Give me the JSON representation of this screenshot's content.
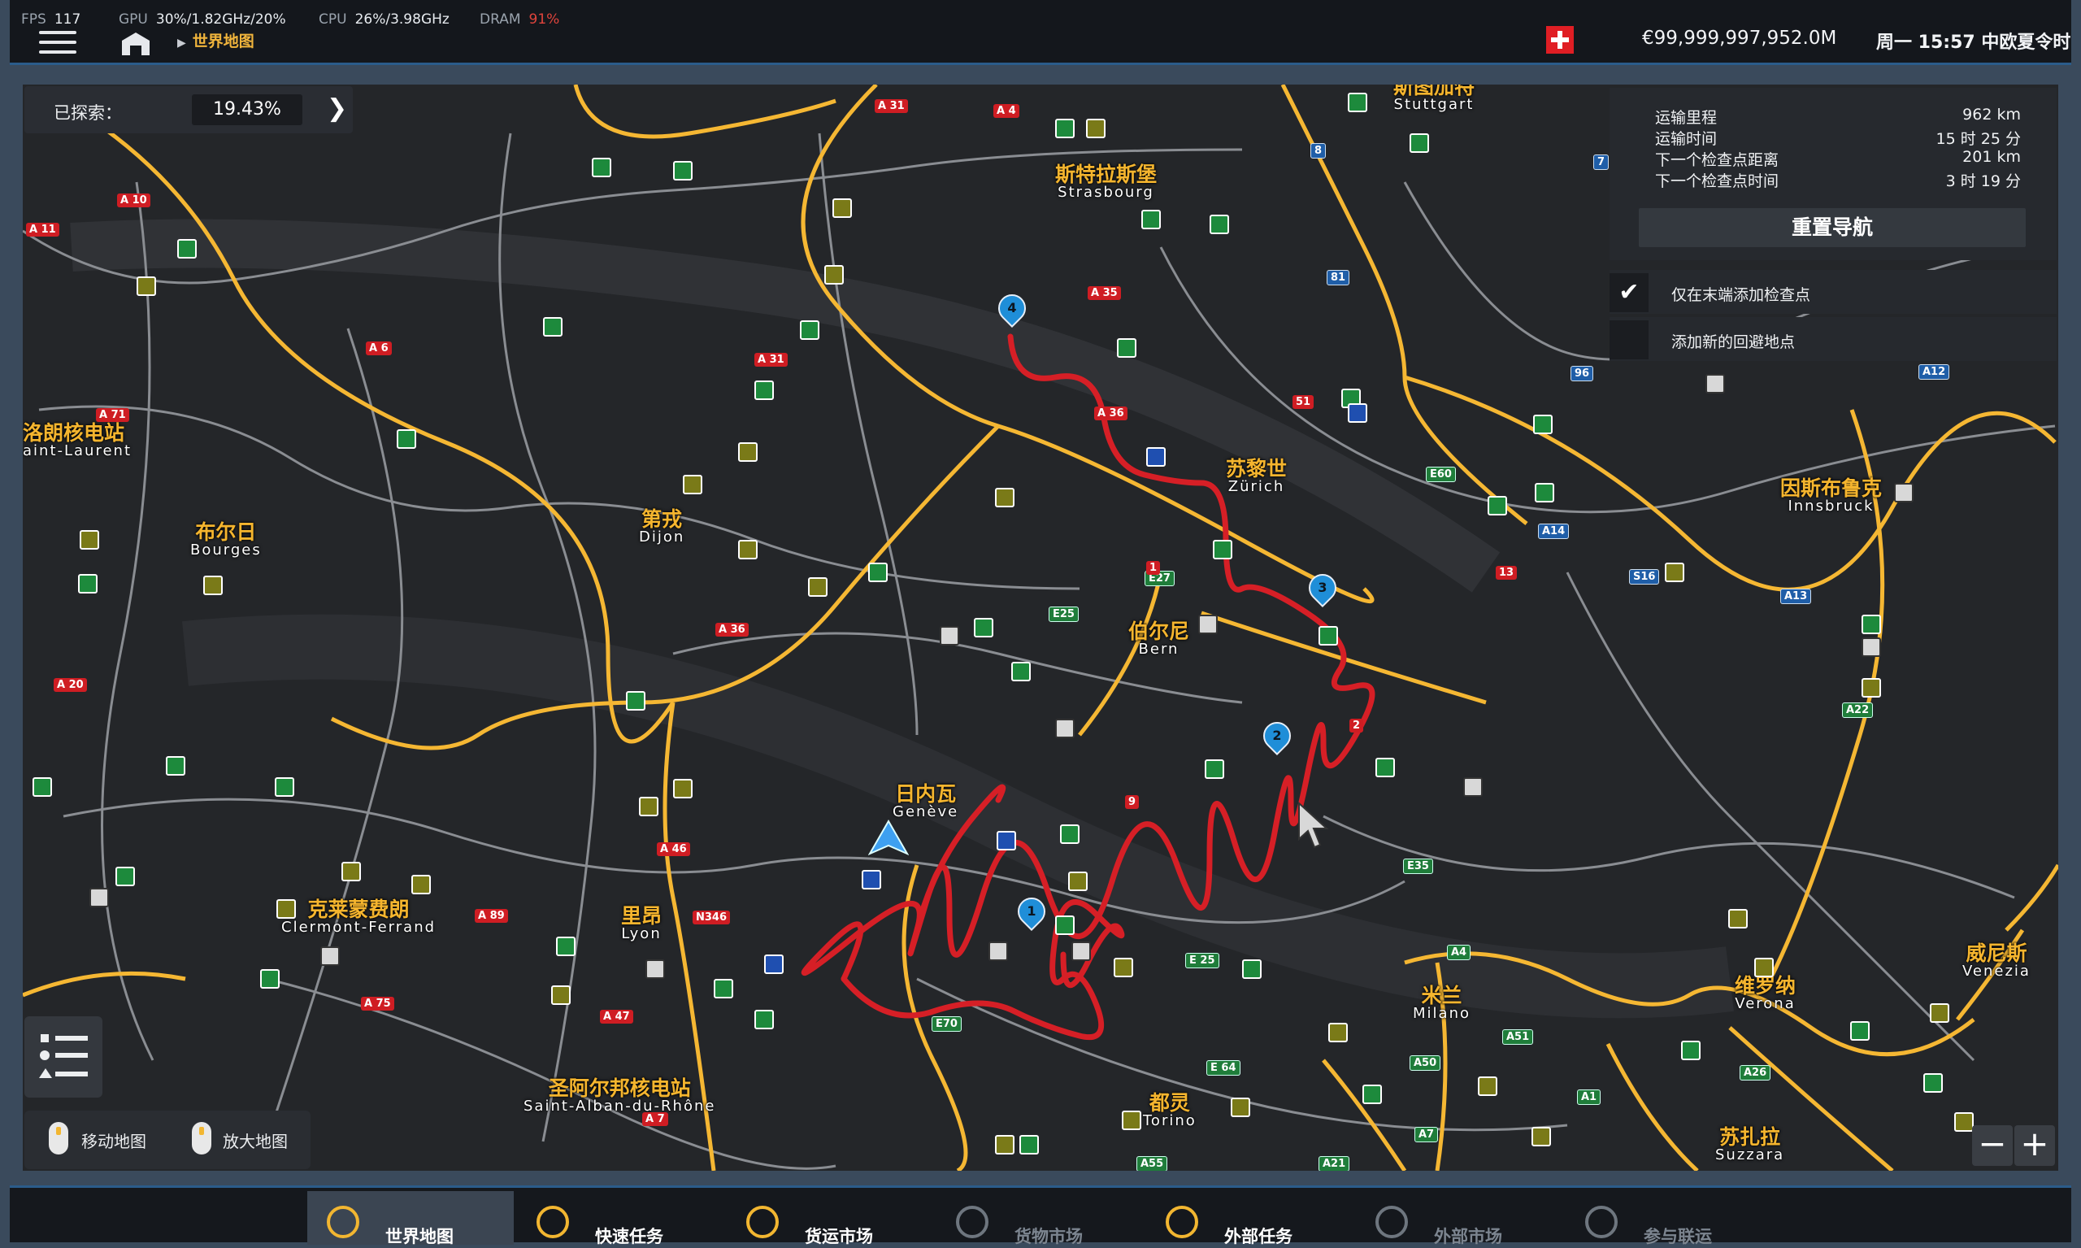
{
  "topbar": {
    "fps_label": "FPS",
    "fps": "117",
    "gpu_label": "GPU",
    "gpu": "30%/1.82GHz/20%",
    "cpu_label": "CPU",
    "cpu": "26%/3.98GHz",
    "dram_label": "DRAM",
    "dram": "91%",
    "breadcrumb": "世界地图",
    "money": "€99,999,997,952.0M",
    "clock": "周一 15:57 中欧夏令时"
  },
  "explored": {
    "label": "已探索：",
    "value": "19.43%"
  },
  "nav": {
    "rows": [
      {
        "label": "运输里程",
        "value": "962 km"
      },
      {
        "label": "运输时间",
        "value": "15 时 25 分"
      },
      {
        "label": "下一个检查点距离",
        "value": "201 km"
      },
      {
        "label": "下一个检查点时间",
        "value": "3 时 19 分"
      }
    ],
    "reset_button": "重置导航",
    "option1": "仅在末端添加检查点",
    "option2": "添加新的回避地点"
  },
  "cities": [
    {
      "cn": "斯特拉斯堡",
      "en": "Strasbourg"
    },
    {
      "cn": "苏黎世",
      "en": "Zürich"
    },
    {
      "cn": "伯尔尼",
      "en": "Bern"
    },
    {
      "cn": "日内瓦",
      "en": "Genève"
    },
    {
      "cn": "第戎",
      "en": "Dijon"
    },
    {
      "cn": "布尔日",
      "en": "Bourges"
    },
    {
      "cn": "克莱蒙费朗",
      "en": "Clermont-Ferrand"
    },
    {
      "cn": "里昂",
      "en": "Lyon"
    },
    {
      "cn": "圣阿尔邦核电站",
      "en": "Saint-Alban-du-Rhône"
    },
    {
      "cn": "都灵",
      "en": "Torino"
    },
    {
      "cn": "米兰",
      "en": "Milano"
    },
    {
      "cn": "维罗纳",
      "en": "Verona"
    },
    {
      "cn": "苏扎拉",
      "en": "Suzzara"
    },
    {
      "cn": "威尼斯",
      "en": "Venezia"
    },
    {
      "cn": "因斯布鲁克",
      "en": "Innsbruck"
    },
    {
      "cn": "洛朗核电站",
      "en": "aint-Laurent"
    },
    {
      "cn": "斯图加特",
      "en": "Stuttgart"
    }
  ],
  "waypoints": [
    "4",
    "3",
    "2",
    "1"
  ],
  "roads": [
    "A 31",
    "A 4",
    "A 35",
    "A 36",
    "A 6",
    "A 31",
    "A 36",
    "A 10",
    "A 11",
    "A 71",
    "A 20",
    "A 46",
    "A 89",
    "A 47",
    "A 75",
    "N346",
    "A 7",
    "E25",
    "E27",
    "E35",
    "E60",
    "A12",
    "A13",
    "A14",
    "S16",
    "A22",
    "A4",
    "A1",
    "A7",
    "A21",
    "A26",
    "A50",
    "A51",
    "A55",
    "E 25",
    "E 64",
    "E70",
    "96",
    "81",
    "8",
    "7",
    "1",
    "9",
    "13",
    "2",
    "51"
  ],
  "hints": {
    "move": "移动地图",
    "zoom": "放大地图"
  },
  "zoom": {
    "minus": "−",
    "plus": "+"
  },
  "tabs": [
    "世界地图",
    "快速任务",
    "货运市场",
    "货物市场",
    "外部任务",
    "外部市场",
    "参与联运"
  ],
  "colors": {
    "route": "#d61f26",
    "highway": "#f5b733",
    "road": "#8a8d92",
    "accent": "#2b5c8a"
  }
}
